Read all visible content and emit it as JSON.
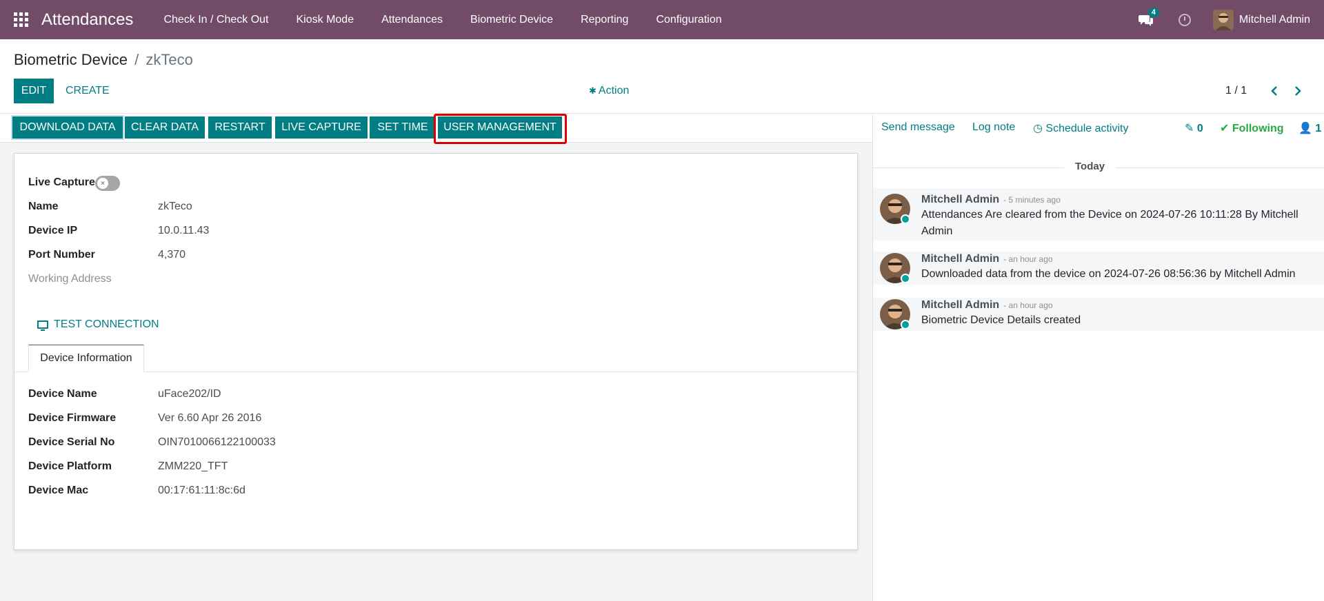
{
  "app": {
    "title": "Attendances",
    "menu": [
      "Check In / Check Out",
      "Kiosk Mode",
      "Attendances",
      "Biometric Device",
      "Reporting",
      "Configuration"
    ],
    "chat_badge": "4",
    "user_name": "Mitchell Admin",
    "brand_color": "#714b67",
    "accent_color": "#017e84"
  },
  "breadcrumb": {
    "parent": "Biometric Device",
    "separator": "/",
    "current": "zkTeco"
  },
  "control": {
    "edit": "EDIT",
    "create": "CREATE",
    "action": "Action",
    "pager": "1 / 1"
  },
  "statusbar": {
    "buttons": [
      "DOWNLOAD DATA",
      "CLEAR DATA",
      "RESTART",
      "LIVE CAPTURE",
      "SET TIME",
      "USER MANAGEMENT"
    ],
    "highlighted": "USER MANAGEMENT"
  },
  "form": {
    "live_capture_label": "Live Capture",
    "live_capture_on": false,
    "fields": [
      {
        "label": "Name",
        "value": "zkTeco"
      },
      {
        "label": "Device IP",
        "value": "10.0.11.43"
      },
      {
        "label": "Port Number",
        "value": "4,370"
      },
      {
        "label": "Working Address",
        "value": ""
      }
    ],
    "test_connection": "TEST CONNECTION",
    "tab": "Device Information",
    "device_info": [
      {
        "label": "Device Name",
        "value": "uFace202/ID"
      },
      {
        "label": "Device Firmware",
        "value": "Ver 6.60 Apr 26 2016"
      },
      {
        "label": "Device Serial No",
        "value": "OIN7010066122100033"
      },
      {
        "label": "Device Platform",
        "value": "ZMM220_TFT"
      },
      {
        "label": "Device Mac",
        "value": "00:17:61:11:8c:6d"
      }
    ]
  },
  "chatter": {
    "send_message": "Send message",
    "log_note": "Log note",
    "schedule_activity": "Schedule activity",
    "attachments": "0",
    "following": "Following",
    "followers": "1",
    "date_separator": "Today",
    "messages": [
      {
        "author": "Mitchell Admin",
        "time": "- 5 minutes ago",
        "body": "Attendances Are cleared from the Device on 2024-07-26 10:11:28 By Mitchell Admin"
      },
      {
        "author": "Mitchell Admin",
        "time": "- an hour ago",
        "body": "Downloaded data from the device on 2024-07-26 08:56:36 by Mitchell Admin"
      },
      {
        "author": "Mitchell Admin",
        "time": "- an hour ago",
        "body": "Biometric Device Details created"
      }
    ]
  }
}
